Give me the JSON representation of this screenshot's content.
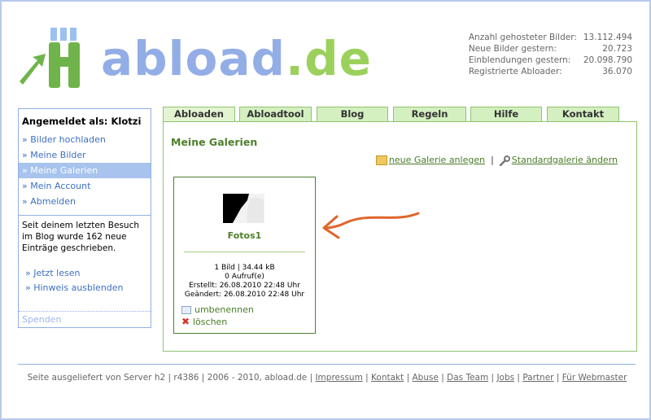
{
  "logo": {
    "part1": "abload",
    "part2": ".de"
  },
  "stats": [
    {
      "label": "Anzahl gehosteter Bilder:",
      "value": "13.112.494"
    },
    {
      "label": "Neue Bilder gestern:",
      "value": "20.723"
    },
    {
      "label": "Einblendungen gestern:",
      "value": "20.098.790"
    },
    {
      "label": "Registrierte Abloader:",
      "value": "36.070"
    }
  ],
  "sidebar": {
    "title": "Angemeldet als: Klotzi",
    "items": [
      {
        "label": "» Bilder hochladen"
      },
      {
        "label": "» Meine Bilder"
      },
      {
        "label": "» Meine Galerien"
      },
      {
        "label": "» Mein Account"
      },
      {
        "label": "» Abmelden"
      }
    ],
    "note": "Seit deinem letzten Besuch im Blog wurde 162 neue Einträge geschrieben.",
    "links": [
      {
        "label": "» Jetzt lesen"
      },
      {
        "label": "» Hinweis ausblenden"
      }
    ],
    "footer": "Spenden"
  },
  "tabs": [
    {
      "label": "Abloaden"
    },
    {
      "label": "Abloadtool"
    },
    {
      "label": "Blog"
    },
    {
      "label": "Regeln"
    },
    {
      "label": "Hilfe"
    },
    {
      "label": "Kontakt"
    }
  ],
  "content": {
    "title": "Meine Galerien",
    "new_gallery": "neue Galerie anlegen",
    "separator": "|",
    "default_gallery": "Standardgalerie ändern"
  },
  "gallery": {
    "name": "Fotos1",
    "info": [
      "1 Bild | 34.44 kB",
      "0 Aufruf(e)",
      "Erstellt: 26.08.2010 22:48 Uhr",
      "Geändert: 26.08.2010 22:48 Uhr"
    ],
    "rename": "umbenennen",
    "delete": "löschen"
  },
  "footer": {
    "text": "Seite ausgeliefert von Server h2 | r4386 | 2006 - 2010, abload.de |",
    "links": [
      "Impressum",
      "Kontakt",
      "Abuse",
      "Das Team",
      "Jobs",
      "Partner",
      "Für Webmaster"
    ]
  },
  "colors": {
    "accent_blue": "#8fb0e5",
    "accent_green": "#8fc46d",
    "title_green": "#4e7f2b",
    "arrow": "#e0652c"
  }
}
